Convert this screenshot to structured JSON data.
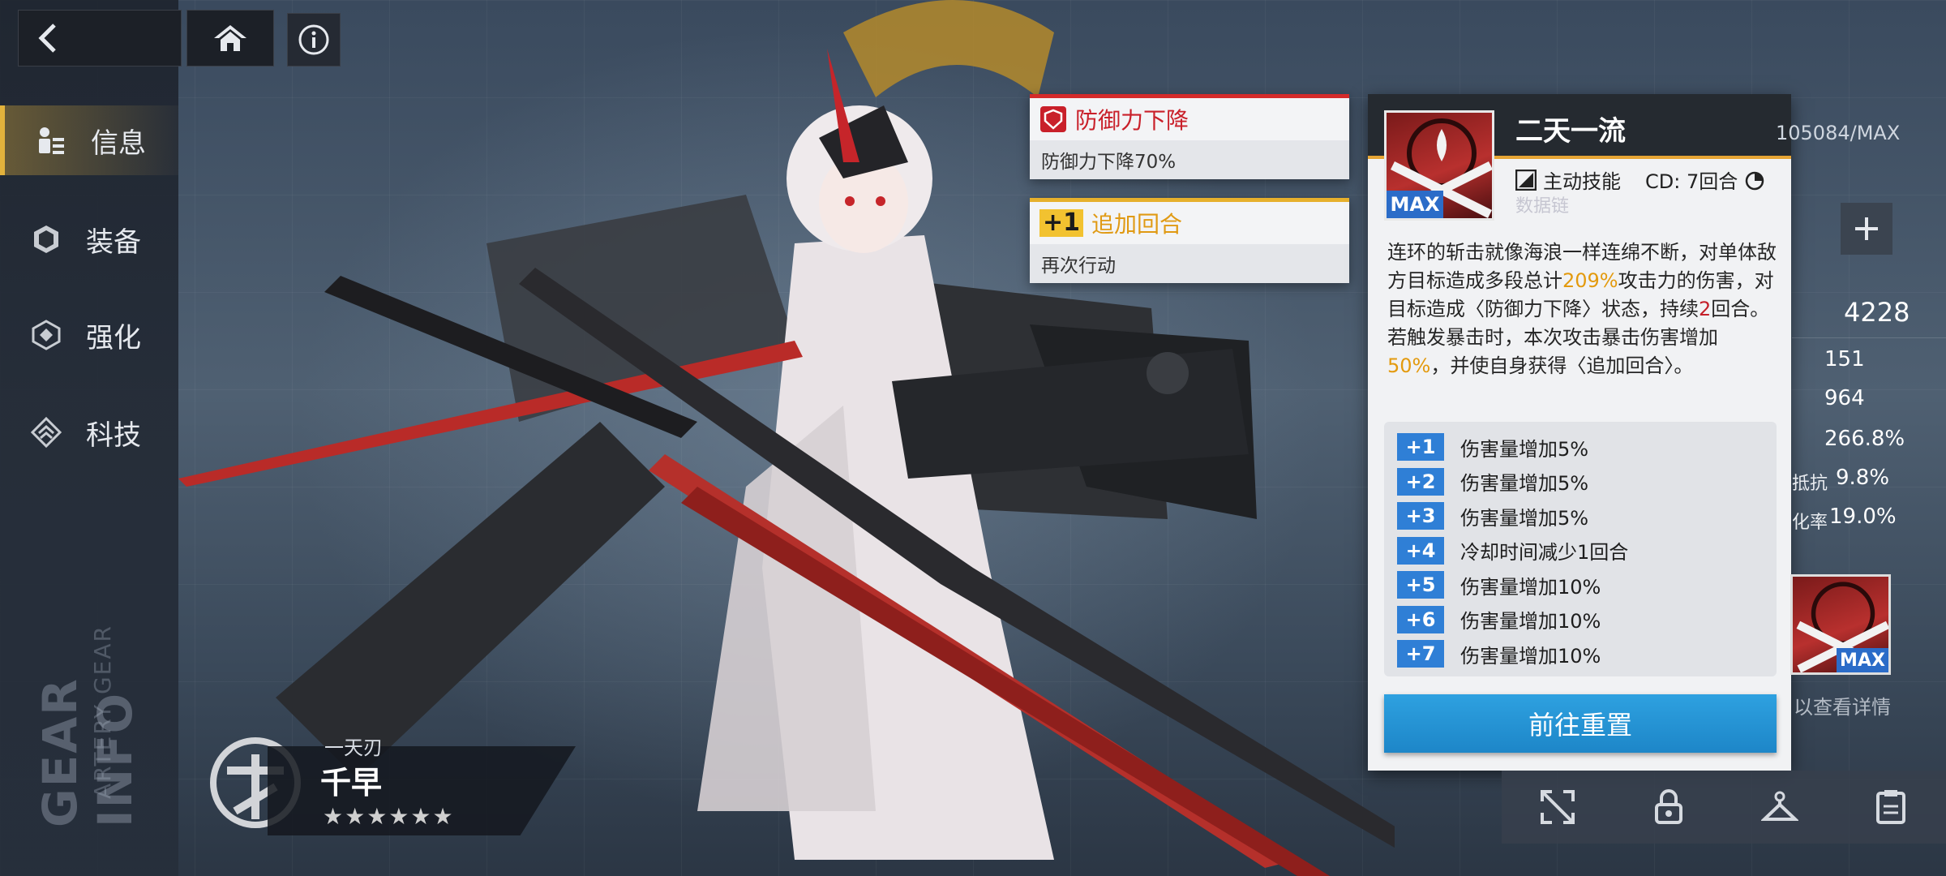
{
  "nav": {
    "items": [
      {
        "label": "信息",
        "icon": "person-info-icon",
        "active": true
      },
      {
        "label": "装备",
        "icon": "armor-icon",
        "active": false
      },
      {
        "label": "强化",
        "icon": "enhance-icon",
        "active": false
      },
      {
        "label": "科技",
        "icon": "tech-icon",
        "active": false
      }
    ]
  },
  "watermark": {
    "big": "GEAR INFO",
    "small": "ARTERY GEAR"
  },
  "character": {
    "subtitle": "一天刃",
    "name": "千早",
    "stars": "★★★★★★",
    "star_count": 6
  },
  "status_effects": [
    {
      "title": "防御力下降",
      "desc": "防御力下降70%",
      "color": "#c9202a",
      "icon": "shield-down-icon"
    },
    {
      "badge": "+1",
      "title": "追加回合",
      "desc": "再次行动",
      "color": "#e09a14"
    }
  ],
  "skill": {
    "name": "二天一流",
    "level_tag": "MAX",
    "type": "主动技能",
    "cd": "CD: 7回合",
    "faded_text": "数据链",
    "description": {
      "p1": "连环的斩击就像海浪一样连绵不断，对单体敌方目标造成多段总计",
      "v1": "209%",
      "p2": "攻击力的伤害，对目标造成〈防御力下降〉状态，持续",
      "v2": "2",
      "p3": "回合。若触发暴击时，本次攻击暴击伤害增加",
      "v3": "50%",
      "p4": "，并使自身获得〈追加回合〉。"
    },
    "upgrades": [
      {
        "badge": "+1",
        "text": "伤害量增加5%"
      },
      {
        "badge": "+2",
        "text": "伤害量增加5%"
      },
      {
        "badge": "+3",
        "text": "伤害量增加5%"
      },
      {
        "badge": "+4",
        "text": "冷却时间减少1回合"
      },
      {
        "badge": "+5",
        "text": "伤害量增加10%"
      },
      {
        "badge": "+6",
        "text": "伤害量增加10%"
      },
      {
        "badge": "+7",
        "text": "伤害量增加10%"
      }
    ],
    "reset_label": "前往重置"
  },
  "right_panel": {
    "exp": "105084/MAX",
    "power": "4228",
    "stats": [
      {
        "label": "",
        "value": "151"
      },
      {
        "label": "",
        "value": "964"
      },
      {
        "label": "",
        "value": "266.8%"
      },
      {
        "label": "抵抗",
        "value": "9.8%"
      },
      {
        "label": "化率",
        "value": "19.0%"
      }
    ],
    "max_tag": "MAX",
    "hint": "以查看详情"
  },
  "colors": {
    "accent_gold": "#e2b23c",
    "debuff_red": "#c9202a",
    "buff_yellow": "#e09a14",
    "upgrade_blue": "#2f7fd6",
    "button_blue": "#1d86c8"
  }
}
